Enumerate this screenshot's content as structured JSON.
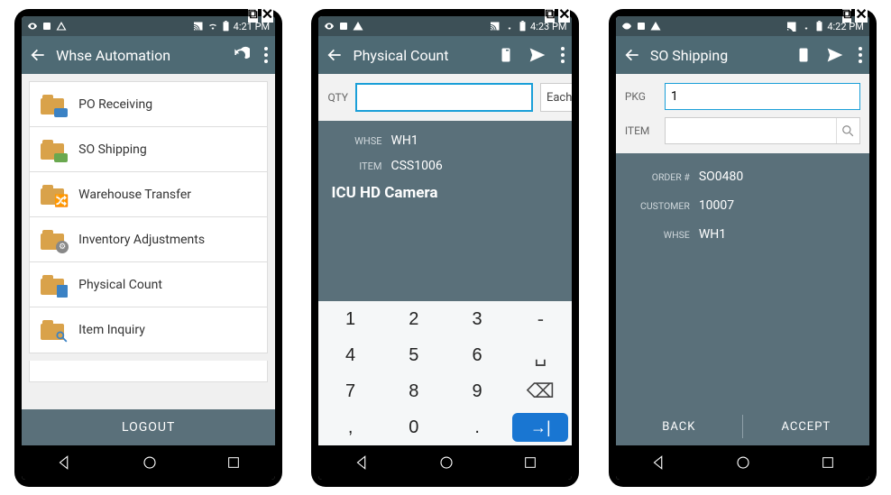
{
  "screens": [
    {
      "status_time": "4:21 PM",
      "title": "Whse Automation",
      "menu": [
        {
          "label": "PO Receiving"
        },
        {
          "label": "SO Shipping"
        },
        {
          "label": "Warehouse Transfer"
        },
        {
          "label": "Inventory Adjustments"
        },
        {
          "label": "Physical Count"
        },
        {
          "label": "Item Inquiry"
        }
      ],
      "logout_label": "LOGOUT"
    },
    {
      "status_time": "4:23 PM",
      "title": "Physical Count",
      "qty_label": "QTY",
      "qty_value": "",
      "unit_selected": "Each",
      "info": {
        "whse_label": "WHSE",
        "whse_value": "WH1",
        "item_label": "ITEM",
        "item_value": "CSS1006",
        "item_name": "ICU HD Camera"
      },
      "keypad": [
        "1",
        "2",
        "3",
        "-",
        "4",
        "5",
        "6",
        "␣",
        "7",
        "8",
        "9",
        "⌫",
        ",",
        "0",
        ".",
        "→"
      ]
    },
    {
      "status_time": "4:22 PM",
      "title": "SO Shipping",
      "pkg_label": "PKG",
      "pkg_value": "1",
      "item_label": "ITEM",
      "item_value": "",
      "details": {
        "order_label": "ORDER #",
        "order_value": "SO0480",
        "customer_label": "CUSTOMER",
        "customer_value": "10007",
        "whse_label": "WHSE",
        "whse_value": "WH1"
      },
      "back_label": "BACK",
      "accept_label": "ACCEPT"
    }
  ]
}
